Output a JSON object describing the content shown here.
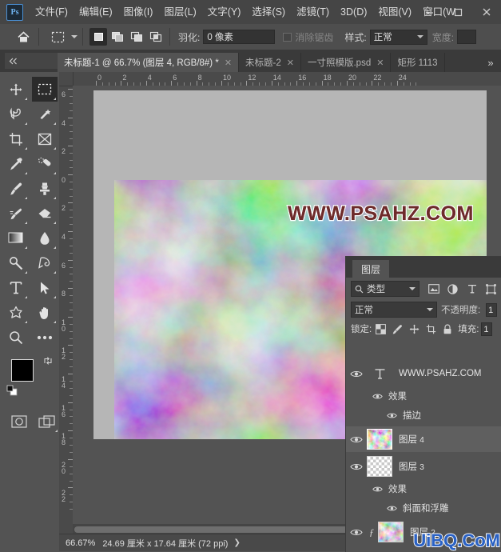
{
  "app": {
    "logo_text": "Ps",
    "window_controls": [
      {
        "name": "minimize-button",
        "glyph": "—"
      },
      {
        "name": "maximize-button",
        "glyph": "□"
      },
      {
        "name": "close-button",
        "glyph": "✕"
      }
    ]
  },
  "menubar": {
    "items": [
      {
        "label": "文件(F)"
      },
      {
        "label": "编辑(E)"
      },
      {
        "label": "图像(I)"
      },
      {
        "label": "图层(L)"
      },
      {
        "label": "文字(Y)"
      },
      {
        "label": "选择(S)"
      },
      {
        "label": "滤镜(T)"
      },
      {
        "label": "3D(D)"
      },
      {
        "label": "视图(V)"
      },
      {
        "label": "窗口(W"
      }
    ]
  },
  "options_bar": {
    "home_icon": "home-icon",
    "tool_preset_icon": "rectangular-marquee-icon",
    "selection_modes": [
      {
        "name": "new-selection",
        "active": true
      },
      {
        "name": "add-to-selection",
        "active": false
      },
      {
        "name": "subtract-from-selection",
        "active": false
      },
      {
        "name": "intersect-selection",
        "active": false
      }
    ],
    "feather_label": "羽化:",
    "feather_value": "0 像素",
    "antialias_label": "消除锯齿",
    "style_label": "样式:",
    "style_value": "正常",
    "width_label": "宽度:",
    "width_value": ""
  },
  "document_tabs": {
    "collapse_label": "",
    "tabs": [
      {
        "label": "未标题-1 @ 66.7% (图层 4, RGB/8#) *",
        "close": "✕",
        "active": true
      },
      {
        "label": "未标题-2",
        "close": "✕",
        "active": false
      },
      {
        "label": "一寸照模版.psd",
        "close": "✕",
        "active": false
      },
      {
        "label": "矩形 1113",
        "close": "",
        "active": false
      }
    ],
    "overflow_glyph": "»"
  },
  "toolbar": {
    "tools": [
      {
        "name": "move-tool",
        "active": false
      },
      {
        "name": "rectangular-marquee-tool",
        "active": true
      },
      {
        "name": "lasso-tool",
        "active": false
      },
      {
        "name": "magic-wand-tool",
        "active": false
      },
      {
        "name": "crop-tool",
        "active": false
      },
      {
        "name": "frame-tool",
        "active": false
      },
      {
        "name": "eyedropper-tool",
        "active": false
      },
      {
        "name": "healing-brush-tool",
        "active": false
      },
      {
        "name": "brush-tool",
        "active": false
      },
      {
        "name": "clone-stamp-tool",
        "active": false
      },
      {
        "name": "history-brush-tool",
        "active": false
      },
      {
        "name": "eraser-tool",
        "active": false
      },
      {
        "name": "gradient-tool",
        "active": false
      },
      {
        "name": "blur-tool",
        "active": false
      },
      {
        "name": "dodge-tool",
        "active": false
      },
      {
        "name": "pen-tool",
        "active": false
      },
      {
        "name": "type-tool",
        "active": false
      },
      {
        "name": "path-selection-tool",
        "active": false
      },
      {
        "name": "shape-tool",
        "active": false
      },
      {
        "name": "hand-tool",
        "active": false
      },
      {
        "name": "zoom-tool",
        "active": false
      },
      {
        "name": "more-tools",
        "active": false
      }
    ],
    "foreground_color": "#000000",
    "background_color": "#ffffff",
    "quickmask_icon": "quick-mask-icon",
    "screenmode_icon": "screen-mode-icon"
  },
  "rulers": {
    "unit": "cm",
    "horizontal_ticks": [
      "0",
      "2",
      "4",
      "6",
      "8",
      "10",
      "12",
      "14",
      "16",
      "18",
      "20",
      "22",
      "24"
    ],
    "vertical_ticks": [
      "6",
      "4",
      "2",
      "0",
      "2",
      "4",
      "6",
      "8",
      "10",
      "12",
      "14",
      "16",
      "18",
      "20",
      "22"
    ]
  },
  "canvas": {
    "watermark": "WWW.PSAHZ.COM",
    "watermark_color": "#6e2b2b",
    "watermark_stroke": "#ffffff"
  },
  "status_bar": {
    "zoom": "66.67%",
    "dimensions": "24.69 厘米 x 17.64 厘米 (72 ppi)",
    "arrow": "❯"
  },
  "layers_panel": {
    "tab_label": "图层",
    "filter_placeholder": "类型",
    "filter_icons": [
      {
        "name": "filter-pixel-icon"
      },
      {
        "name": "filter-adjustment-icon"
      },
      {
        "name": "filter-type-icon"
      },
      {
        "name": "filter-shape-icon"
      }
    ],
    "blend_mode": "正常",
    "opacity_label": "不透明度:",
    "opacity_value": "1",
    "lock_label": "锁定:",
    "lock_icons": [
      {
        "name": "lock-transparent-pixels-icon"
      },
      {
        "name": "lock-image-pixels-icon"
      },
      {
        "name": "lock-position-icon"
      },
      {
        "name": "lock-artboard-icon"
      },
      {
        "name": "lock-all-icon"
      }
    ],
    "fill_label": "填充:",
    "fill_value": "1",
    "layers": [
      {
        "name": "WWW.PSAHZ.COM",
        "kind": "text",
        "visible": true,
        "selected": false,
        "effects_label": "效果",
        "effects": [
          "描边"
        ]
      },
      {
        "name": "图层",
        "index": "4",
        "kind": "pixel",
        "visible": true,
        "selected": true,
        "effects": []
      },
      {
        "name": "图层",
        "index": "3",
        "kind": "transparent",
        "visible": true,
        "selected": false,
        "effects_label": "效果",
        "effects": [
          "斜面和浮雕"
        ]
      },
      {
        "name": "图层",
        "index": "2",
        "kind": "pixel",
        "visible": true,
        "selected": false,
        "has_fx": true,
        "fx_mark": "ƒ",
        "effects": []
      }
    ]
  },
  "page_watermark": {
    "text": "UiBQ.CoM",
    "color": "#2b62c4"
  }
}
